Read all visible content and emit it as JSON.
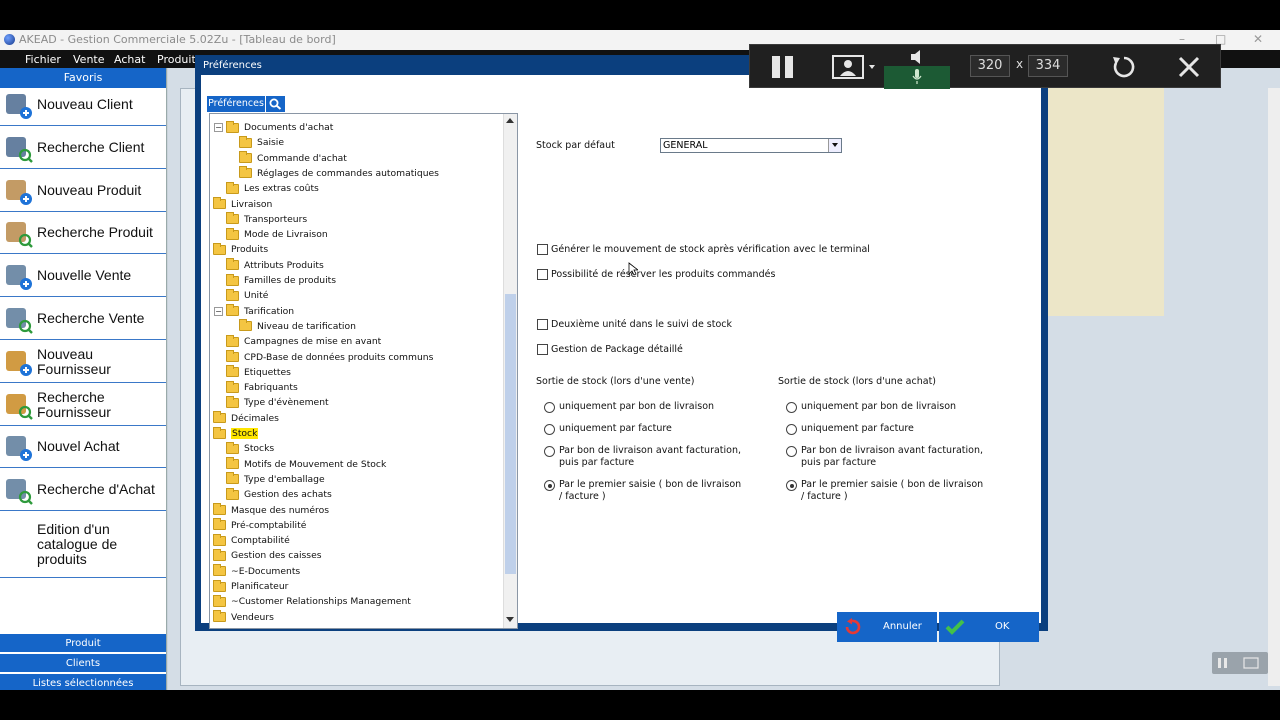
{
  "window": {
    "title": "AKEAD - Gestion Commerciale 5.02Zu - [Tableau de bord]",
    "controls": [
      "–",
      "□",
      "✕"
    ]
  },
  "menu": [
    "Fichier",
    "Vente",
    "Achat",
    "Produit"
  ],
  "sidebar": {
    "header": "Favoris",
    "items": [
      {
        "label": "Nouveau Client",
        "icon": "new-client-icon"
      },
      {
        "label": "Recherche Client",
        "icon": "search-client-icon"
      },
      {
        "label": "Nouveau Produit",
        "icon": "new-product-icon"
      },
      {
        "label": "Recherche Produit",
        "icon": "search-product-icon"
      },
      {
        "label": "Nouvelle Vente",
        "icon": "new-sale-icon"
      },
      {
        "label": "Recherche Vente",
        "icon": "search-sale-icon"
      },
      {
        "label": "Nouveau Fournisseur",
        "icon": "new-supplier-icon"
      },
      {
        "label": "Recherche Fournisseur",
        "icon": "search-supplier-icon"
      },
      {
        "label": "Nouvel Achat",
        "icon": "new-purchase-icon"
      },
      {
        "label": "Recherche d'Achat",
        "icon": "search-purchase-icon"
      },
      {
        "label": "Edition d'un catalogue de produits",
        "icon": ""
      }
    ],
    "bottom_tabs": [
      "Produit",
      "Clients",
      "Listes sélectionnées"
    ]
  },
  "dialog": {
    "title": "Préférences",
    "tab": "Préférences",
    "tree": [
      {
        "label": "Documents d'achat",
        "level": 1,
        "expander": "−"
      },
      {
        "label": "Saisie",
        "level": 2
      },
      {
        "label": "Commande d'achat",
        "level": 2
      },
      {
        "label": "Réglages de commandes automatiques",
        "level": 2
      },
      {
        "label": "Les extras coûts",
        "level": 1
      },
      {
        "label": "Livraison",
        "level": 0
      },
      {
        "label": "Transporteurs",
        "level": 1
      },
      {
        "label": "Mode de Livraison",
        "level": 1
      },
      {
        "label": "Produits",
        "level": 0
      },
      {
        "label": "Attributs Produits",
        "level": 1
      },
      {
        "label": "Familles de produits",
        "level": 1
      },
      {
        "label": "Unité",
        "level": 1
      },
      {
        "label": "Tarification",
        "level": 1,
        "expander": "−"
      },
      {
        "label": "Niveau de tarification",
        "level": 2
      },
      {
        "label": "Campagnes de mise en avant",
        "level": 1
      },
      {
        "label": "CPD-Base de données produits communs",
        "level": 1
      },
      {
        "label": "Etiquettes",
        "level": 1
      },
      {
        "label": "Fabriquants",
        "level": 1
      },
      {
        "label": "Type d'évènement",
        "level": 1
      },
      {
        "label": "Décimales",
        "level": 0
      },
      {
        "label": "Stock",
        "level": 0,
        "selected": true
      },
      {
        "label": "Stocks",
        "level": 1
      },
      {
        "label": "Motifs de Mouvement de Stock",
        "level": 1
      },
      {
        "label": "Type d'emballage",
        "level": 1
      },
      {
        "label": "Gestion des achats",
        "level": 1
      },
      {
        "label": "Masque des numéros",
        "level": 0
      },
      {
        "label": "Pré-comptabilité",
        "level": 0
      },
      {
        "label": "Comptabilité",
        "level": 0
      },
      {
        "label": "Gestion des caisses",
        "level": 0
      },
      {
        "label": "~E-Documents",
        "level": 0
      },
      {
        "label": "Planificateur",
        "level": 0
      },
      {
        "label": "~Customer Relationships Management",
        "level": 0
      },
      {
        "label": "Vendeurs",
        "level": 0
      }
    ],
    "form": {
      "default_stock_label": "Stock par défaut",
      "default_stock_value": "GENERAL",
      "checkboxes": [
        {
          "label": "Générer le mouvement de stock après vérification avec le terminal",
          "checked": false
        },
        {
          "label": "Possibilité de réserver les produits commandés",
          "checked": false
        },
        {
          "label": "Deuxième unité dans le suivi de stock",
          "checked": false
        },
        {
          "label": "Gestion de Package détaillé",
          "checked": false
        }
      ],
      "sale_group": {
        "title": "Sortie de stock (lors d'une vente)",
        "options": [
          "uniquement par bon de livraison",
          "uniquement par facture",
          "Par bon de livraison avant facturation, puis par facture",
          "Par le premier saisie ( bon de livraison / facture )"
        ],
        "selected": 3
      },
      "purchase_group": {
        "title": "Sortie de stock (lors d'une achat)",
        "options": [
          "uniquement par bon de livraison",
          "uniquement par facture",
          "Par bon de livraison avant facturation, puis par facture",
          "Par le premier saisie ( bon de livraison / facture )"
        ],
        "selected": 3
      }
    },
    "buttons": {
      "cancel": "Annuler",
      "ok": "OK"
    }
  },
  "recorder": {
    "width": "320",
    "height": "334",
    "times": "x"
  },
  "colors": {
    "accent": "#1565c8",
    "dialog_frame": "#0b3f7e",
    "selection": "#ffe600"
  }
}
